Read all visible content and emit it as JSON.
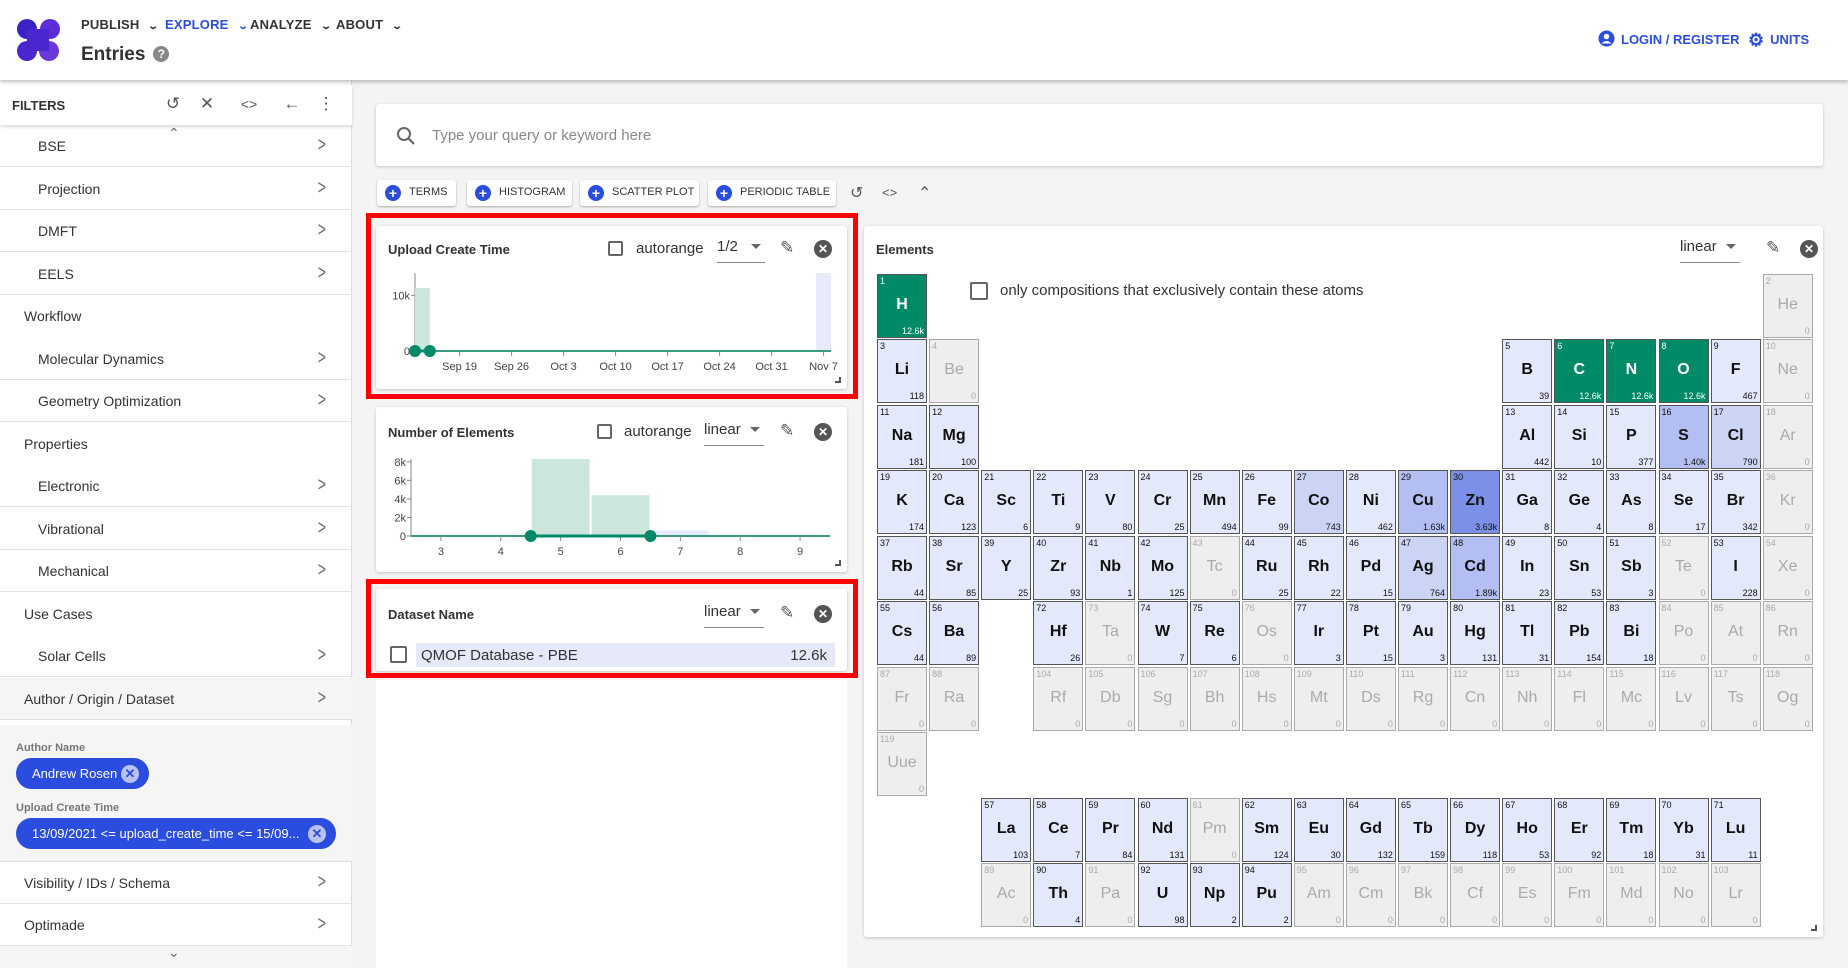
{
  "header": {
    "nav": [
      {
        "label": "PUBLISH",
        "active": false
      },
      {
        "label": "EXPLORE",
        "active": true
      },
      {
        "label": "ANALYZE",
        "active": false
      },
      {
        "label": "ABOUT",
        "active": false
      }
    ],
    "title": "Entries",
    "help": "?",
    "login": "LOGIN / REGISTER",
    "units": "UNITS"
  },
  "sidebar": {
    "title": "FILTERS",
    "items": [
      {
        "label": "BSE",
        "type": "sub"
      },
      {
        "label": "Projection",
        "type": "sub"
      },
      {
        "label": "DMFT",
        "type": "sub"
      },
      {
        "label": "EELS",
        "type": "sub"
      },
      {
        "label": "Workflow",
        "type": "group"
      },
      {
        "label": "Molecular Dynamics",
        "type": "sub"
      },
      {
        "label": "Geometry Optimization",
        "type": "sub"
      },
      {
        "label": "Properties",
        "type": "group"
      },
      {
        "label": "Electronic",
        "type": "sub"
      },
      {
        "label": "Vibrational",
        "type": "sub"
      },
      {
        "label": "Mechanical",
        "type": "sub"
      },
      {
        "label": "Use Cases",
        "type": "group"
      },
      {
        "label": "Solar Cells",
        "type": "sub"
      },
      {
        "label": "Author / Origin / Dataset",
        "type": "groupchev"
      }
    ],
    "active_filters": {
      "author_label": "Author Name",
      "author_value": "Andrew Rosen",
      "upload_label": "Upload Create Time",
      "upload_value": "13/09/2021 <= upload_create_time <= 15/09..."
    },
    "bottom_items": [
      {
        "label": "Visibility / IDs / Schema"
      },
      {
        "label": "Optimade"
      }
    ]
  },
  "search": {
    "placeholder": "Type your query or keyword here"
  },
  "widget_buttons": [
    "TERMS",
    "HISTOGRAM",
    "SCATTER PLOT",
    "PERIODIC TABLE"
  ],
  "widgets": {
    "upload": {
      "title": "Upload Create Time",
      "autorange": "autorange",
      "scale": "1/2"
    },
    "nelements": {
      "title": "Number of Elements",
      "autorange": "autorange",
      "scale": "linear"
    },
    "dataset": {
      "title": "Dataset Name",
      "scale": "linear",
      "items": [
        {
          "label": "QMOF Database - PBE",
          "count": "12.6k"
        }
      ]
    },
    "elements": {
      "title": "Elements",
      "scale": "linear",
      "exclusive_label": "only compositions that exclusively contain these atoms",
      "selected": [
        1,
        6,
        7,
        8
      ],
      "colors": {
        "selected": "#008a67",
        "zero": "#eeeeee",
        "low": "#e4e8fb",
        "mid": "#ccd4f6",
        "high": "#b3bef2",
        "max": "#7d90e8"
      },
      "items": [
        [
          1,
          "H",
          "12.6k"
        ],
        [
          2,
          "He",
          "0"
        ],
        [
          3,
          "Li",
          "118"
        ],
        [
          4,
          "Be",
          "0"
        ],
        [
          5,
          "B",
          "39"
        ],
        [
          6,
          "C",
          "12.6k"
        ],
        [
          7,
          "N",
          "12.6k"
        ],
        [
          8,
          "O",
          "12.6k"
        ],
        [
          9,
          "F",
          "467"
        ],
        [
          10,
          "Ne",
          "0"
        ],
        [
          11,
          "Na",
          "181"
        ],
        [
          12,
          "Mg",
          "100"
        ],
        [
          13,
          "Al",
          "442"
        ],
        [
          14,
          "Si",
          "10"
        ],
        [
          15,
          "P",
          "377"
        ],
        [
          16,
          "S",
          "1.40k"
        ],
        [
          17,
          "Cl",
          "790"
        ],
        [
          18,
          "Ar",
          "0"
        ],
        [
          19,
          "K",
          "174"
        ],
        [
          20,
          "Ca",
          "123"
        ],
        [
          21,
          "Sc",
          "6"
        ],
        [
          22,
          "Ti",
          "9"
        ],
        [
          23,
          "V",
          "80"
        ],
        [
          24,
          "Cr",
          "25"
        ],
        [
          25,
          "Mn",
          "494"
        ],
        [
          26,
          "Fe",
          "99"
        ],
        [
          27,
          "Co",
          "743"
        ],
        [
          28,
          "Ni",
          "462"
        ],
        [
          29,
          "Cu",
          "1.63k"
        ],
        [
          30,
          "Zn",
          "3.63k"
        ],
        [
          31,
          "Ga",
          "8"
        ],
        [
          32,
          "Ge",
          "4"
        ],
        [
          33,
          "As",
          "8"
        ],
        [
          34,
          "Se",
          "17"
        ],
        [
          35,
          "Br",
          "342"
        ],
        [
          36,
          "Kr",
          "0"
        ],
        [
          37,
          "Rb",
          "44"
        ],
        [
          38,
          "Sr",
          "85"
        ],
        [
          39,
          "Y",
          "25"
        ],
        [
          40,
          "Zr",
          "93"
        ],
        [
          41,
          "Nb",
          "1"
        ],
        [
          42,
          "Mo",
          "125"
        ],
        [
          43,
          "Tc",
          "0"
        ],
        [
          44,
          "Ru",
          "25"
        ],
        [
          45,
          "Rh",
          "22"
        ],
        [
          46,
          "Pd",
          "15"
        ],
        [
          47,
          "Ag",
          "764"
        ],
        [
          48,
          "Cd",
          "1.89k"
        ],
        [
          49,
          "In",
          "23"
        ],
        [
          50,
          "Sn",
          "53"
        ],
        [
          51,
          "Sb",
          "3"
        ],
        [
          52,
          "Te",
          "0"
        ],
        [
          53,
          "I",
          "228"
        ],
        [
          54,
          "Xe",
          "0"
        ],
        [
          55,
          "Cs",
          "44"
        ],
        [
          56,
          "Ba",
          "89"
        ],
        [
          57,
          "La",
          "103"
        ],
        [
          58,
          "Ce",
          "7"
        ],
        [
          59,
          "Pr",
          "84"
        ],
        [
          60,
          "Nd",
          "131"
        ],
        [
          61,
          "Pm",
          "0"
        ],
        [
          62,
          "Sm",
          "124"
        ],
        [
          63,
          "Eu",
          "30"
        ],
        [
          64,
          "Gd",
          "132"
        ],
        [
          65,
          "Tb",
          "159"
        ],
        [
          66,
          "Dy",
          "118"
        ],
        [
          67,
          "Ho",
          "53"
        ],
        [
          68,
          "Er",
          "92"
        ],
        [
          69,
          "Tm",
          "18"
        ],
        [
          70,
          "Yb",
          "31"
        ],
        [
          71,
          "Lu",
          "11"
        ],
        [
          72,
          "Hf",
          "26"
        ],
        [
          73,
          "Ta",
          "0"
        ],
        [
          74,
          "W",
          "7"
        ],
        [
          75,
          "Re",
          "6"
        ],
        [
          76,
          "Os",
          "0"
        ],
        [
          77,
          "Ir",
          "3"
        ],
        [
          78,
          "Pt",
          "15"
        ],
        [
          79,
          "Au",
          "3"
        ],
        [
          80,
          "Hg",
          "131"
        ],
        [
          81,
          "Tl",
          "31"
        ],
        [
          82,
          "Pb",
          "154"
        ],
        [
          83,
          "Bi",
          "18"
        ],
        [
          84,
          "Po",
          "0"
        ],
        [
          85,
          "At",
          "0"
        ],
        [
          86,
          "Rn",
          "0"
        ],
        [
          87,
          "Fr",
          "0"
        ],
        [
          88,
          "Ra",
          "0"
        ],
        [
          89,
          "Ac",
          "0"
        ],
        [
          90,
          "Th",
          "4"
        ],
        [
          91,
          "Pa",
          "0"
        ],
        [
          92,
          "U",
          "98"
        ],
        [
          93,
          "Np",
          "2"
        ],
        [
          94,
          "Pu",
          "2"
        ],
        [
          95,
          "Am",
          "0"
        ],
        [
          96,
          "Cm",
          "0"
        ],
        [
          97,
          "Bk",
          "0"
        ],
        [
          98,
          "Cf",
          "0"
        ],
        [
          99,
          "Es",
          "0"
        ],
        [
          100,
          "Fm",
          "0"
        ],
        [
          101,
          "Md",
          "0"
        ],
        [
          102,
          "No",
          "0"
        ],
        [
          103,
          "Lr",
          "0"
        ],
        [
          104,
          "Rf",
          "0"
        ],
        [
          105,
          "Db",
          "0"
        ],
        [
          106,
          "Sg",
          "0"
        ],
        [
          107,
          "Bh",
          "0"
        ],
        [
          108,
          "Hs",
          "0"
        ],
        [
          109,
          "Mt",
          "0"
        ],
        [
          110,
          "Ds",
          "0"
        ],
        [
          111,
          "Rg",
          "0"
        ],
        [
          112,
          "Cn",
          "0"
        ],
        [
          113,
          "Nh",
          "0"
        ],
        [
          114,
          "Fl",
          "0"
        ],
        [
          115,
          "Mc",
          "0"
        ],
        [
          116,
          "Lv",
          "0"
        ],
        [
          117,
          "Ts",
          "0"
        ],
        [
          118,
          "Og",
          "0"
        ],
        [
          119,
          "Uue",
          "0"
        ]
      ]
    }
  },
  "chart_data": [
    {
      "type": "bar",
      "title": "Upload Create Time",
      "xrange": [
        "2021-09-13",
        "2021-11-08"
      ],
      "xticks": [
        {
          "date": "2021-09-19",
          "label": "Sep 19"
        },
        {
          "date": "2021-09-26",
          "label": "Sep 26"
        },
        {
          "date": "2021-10-03",
          "label": "Oct 3"
        },
        {
          "date": "2021-10-10",
          "label": "Oct 10"
        },
        {
          "date": "2021-10-17",
          "label": "Oct 17"
        },
        {
          "date": "2021-10-24",
          "label": "Oct 24"
        },
        {
          "date": "2021-10-31",
          "label": "Oct 31"
        },
        {
          "date": "2021-11-07",
          "label": "Nov 7"
        }
      ],
      "yticks": [
        {
          "v": 0,
          "label": "0"
        },
        {
          "v": 10000,
          "label": "10k"
        }
      ],
      "ylim": [
        0,
        14000
      ],
      "bars": [
        {
          "start": "2021-09-13",
          "end": "2021-09-15",
          "value": 11300,
          "selected": true
        },
        {
          "start": "2021-11-06",
          "end": "2021-11-08",
          "value": 14000,
          "selected": false
        }
      ],
      "selection": [
        "2021-09-13",
        "2021-09-15"
      ]
    },
    {
      "type": "bar",
      "title": "Number of Elements",
      "xlim": [
        2.5,
        9.5
      ],
      "xticks": [
        3,
        4,
        5,
        6,
        7,
        8,
        9
      ],
      "yticks": [
        {
          "v": 0,
          "label": "0"
        },
        {
          "v": 2000,
          "label": "2k"
        },
        {
          "v": 4000,
          "label": "4k"
        },
        {
          "v": 6000,
          "label": "6k"
        },
        {
          "v": 8000,
          "label": "8k"
        }
      ],
      "ylim": [
        0,
        8300
      ],
      "bars": [
        {
          "x": 5,
          "value": 8300,
          "selected": true
        },
        {
          "x": 6,
          "value": 4400,
          "selected": true
        },
        {
          "x": 7,
          "value": 600,
          "selected": false
        }
      ],
      "selection": [
        4.5,
        6.5
      ]
    }
  ]
}
